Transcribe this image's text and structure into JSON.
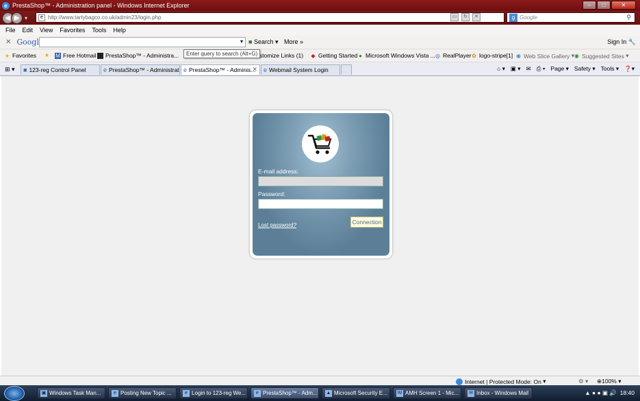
{
  "window": {
    "title": "PrestaShop™ - Administration panel - Windows Internet Explorer",
    "controls": {
      "minimize": "–",
      "maximize": "□",
      "close": "✕"
    }
  },
  "address_bar": {
    "url": "http://www.tartybagco.co.uk/admin23/login.php",
    "search_placeholder": "Google"
  },
  "menu": [
    "File",
    "Edit",
    "View",
    "Favorites",
    "Tools",
    "Help"
  ],
  "google_toolbar": {
    "logo": "Google",
    "search_label": "Search",
    "more_label": "More",
    "sign_in": "Sign In",
    "tooltip": "Enter query to search (Alt+G)"
  },
  "favorites_bar": {
    "favorites_label": "Favorites",
    "items": [
      "Free Hotmail",
      "PrestaShop™ - Administra...",
      "Customize Links (1)",
      "Getting Started",
      "Microsoft Windows Vista ...",
      "RealPlayer",
      "logo-stripe[1]",
      "Web Slice Gallery",
      "Suggested Sites"
    ]
  },
  "tabs": [
    {
      "label": "123-reg Control Panel",
      "active": false
    },
    {
      "label": "PrestaShop™ - Administrat...",
      "active": false
    },
    {
      "label": "PrestaShop™ - Adminis...",
      "active": true
    },
    {
      "label": "Webmail System Login",
      "active": false
    }
  ],
  "command_bar": [
    "Page",
    "Safety",
    "Tools"
  ],
  "login": {
    "email_label": "E-mail address:",
    "email_value": "",
    "password_label": "Password:",
    "password_value": "",
    "lost_password": "Lost password?",
    "connect_button": "Connection"
  },
  "status_bar": {
    "zone": "Internet | Protected Mode: On",
    "zoom": "100%"
  },
  "taskbar": {
    "items": [
      {
        "label": "Windows Task Man...",
        "active": false
      },
      {
        "label": "Posting New Topic ...",
        "active": false
      },
      {
        "label": "Login to 123-reg We...",
        "active": false
      },
      {
        "label": "PrestaShop™ - Adm...",
        "active": true
      },
      {
        "label": "Microsoft Security E...",
        "active": false
      },
      {
        "label": "AMH Screen 1 - Mic...",
        "active": false
      },
      {
        "label": "Inbox - Windows Mail",
        "active": false
      }
    ],
    "clock": "18:40"
  },
  "colors": {
    "title_bar": "#7e1a1b",
    "login_panel": "#5c7f97",
    "page_bg": "#f0f0f0"
  }
}
